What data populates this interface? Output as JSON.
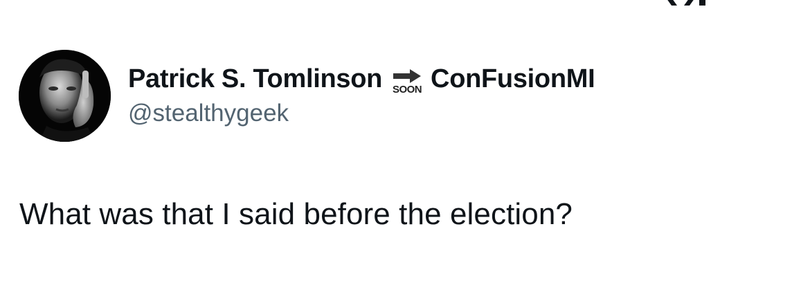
{
  "tweet": {
    "author": {
      "display_name": "Patrick S. Tomlinson",
      "badge": {
        "icon": "arrow-right-icon",
        "label": "SOON"
      },
      "name_suffix": "ConFusionMI",
      "handle": "@stealthygeek"
    },
    "text": "What was that I said before the election?"
  },
  "colors": {
    "text_primary": "#0f1419",
    "text_secondary": "#536471",
    "background": "#ffffff"
  }
}
